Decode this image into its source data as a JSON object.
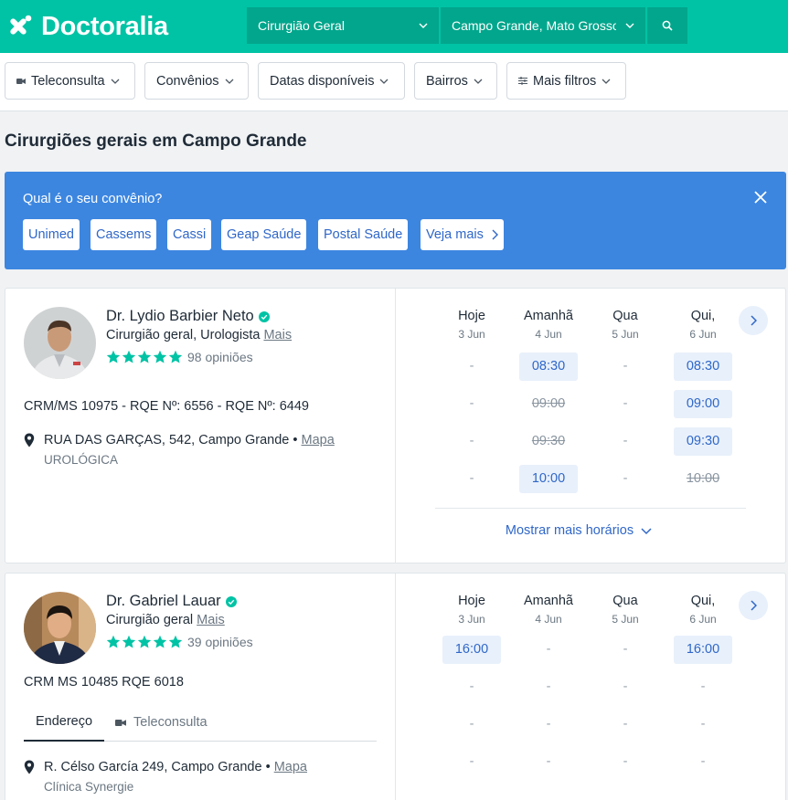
{
  "brand": {
    "name": "Doctoralia"
  },
  "search": {
    "specialty": "Cirurgião Geral",
    "location": "Campo Grande, Mato Grosso do Sul"
  },
  "filters": {
    "telehealth": "Teleconsulta",
    "insurance": "Convênios",
    "dates": "Datas disponíveis",
    "neighborhoods": "Bairros",
    "more": "Mais filtros"
  },
  "page_title": "Cirurgiões gerais em Campo Grande",
  "insurance_banner": {
    "question": "Qual é o seu convênio?",
    "options": [
      "Unimed",
      "Cassems",
      "Cassi",
      "Geap Saúde",
      "Postal Saúde"
    ],
    "see_more": "Veja mais"
  },
  "calendar_days": [
    {
      "name": "Hoje",
      "date": "3 Jun"
    },
    {
      "name": "Amanhã",
      "date": "4 Jun"
    },
    {
      "name": "Qua",
      "date": "5 Jun"
    },
    {
      "name": "Qui,",
      "date": "6 Jun"
    }
  ],
  "doctors": [
    {
      "name": "Dr. Lydio Barbier Neto",
      "specialties": "Cirurgião geral, Urologista",
      "more": "Mais",
      "reviews": "98 opiniões",
      "rating_stars": 5,
      "registration": "CRM/MS 10975 - RQE Nº: 6556 - RQE Nº: 6449",
      "address": "RUA DAS GARÇAS, 542, Campo Grande •",
      "map_link": "Mapa",
      "clinic": "UROLÓGICA",
      "slots": [
        [
          "-",
          "08:30",
          "-",
          "08:30"
        ],
        [
          "-",
          "09:00",
          "-",
          "09:00"
        ],
        [
          "-",
          "09:30",
          "-",
          "09:30"
        ],
        [
          "-",
          "10:00",
          "-",
          "10:00"
        ]
      ],
      "slot_state": [
        [
          "dash",
          "av",
          "dash",
          "av"
        ],
        [
          "dash",
          "taken",
          "dash",
          "av"
        ],
        [
          "dash",
          "taken",
          "dash",
          "av"
        ],
        [
          "dash",
          "av",
          "dash",
          "taken"
        ]
      ],
      "show_more": "Mostrar mais horários"
    },
    {
      "name": "Dr. Gabriel Lauar",
      "specialties": "Cirurgião geral",
      "more": "Mais",
      "reviews": "39 opiniões",
      "rating_stars": 5,
      "registration": "CRM MS 10485 RQE 6018",
      "tabs": {
        "address": "Endereço",
        "telehealth": "Teleconsulta"
      },
      "address": "R. Célso García 249, Campo Grande •",
      "map_link": "Mapa",
      "clinic": "Clínica Synergie",
      "slots": [
        [
          "16:00",
          "-",
          "-",
          "16:00"
        ],
        [
          "-",
          "-",
          "-",
          "-"
        ],
        [
          "-",
          "-",
          "-",
          "-"
        ],
        [
          "-",
          "-",
          "-",
          "-"
        ]
      ],
      "slot_state": [
        [
          "av",
          "dash",
          "dash",
          "av"
        ],
        [
          "dash",
          "dash",
          "dash",
          "dash"
        ],
        [
          "dash",
          "dash",
          "dash",
          "dash"
        ],
        [
          "dash",
          "dash",
          "dash",
          "dash"
        ]
      ]
    }
  ],
  "colors": {
    "brand": "#00c3a5",
    "banner": "#3c86e0",
    "link": "#2f67c9",
    "slot_bg": "#e8f0fb"
  }
}
